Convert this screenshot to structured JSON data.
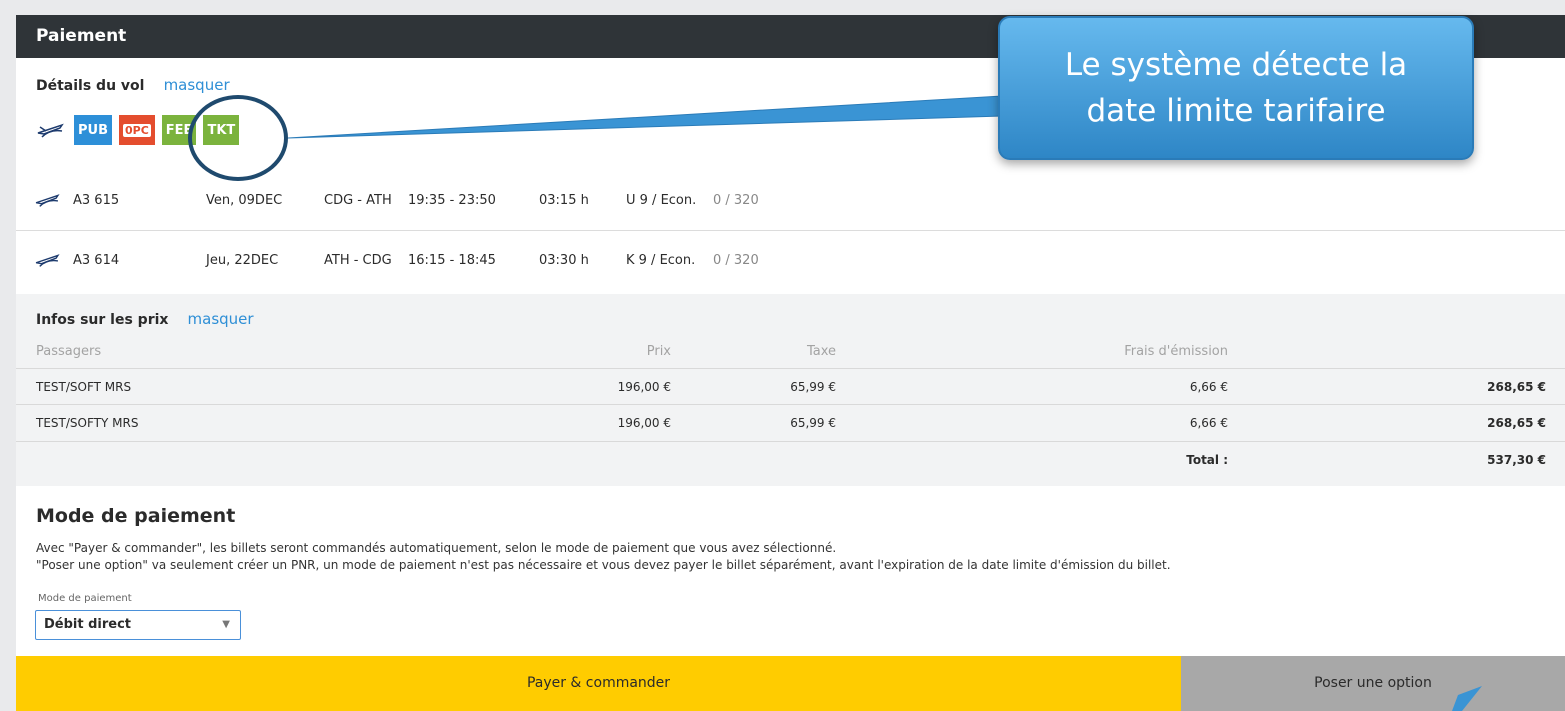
{
  "header": {
    "title": "Paiement"
  },
  "flight_details": {
    "title": "Détails du vol",
    "toggle": "masquer",
    "badges": [
      "PUB",
      "0PC",
      "FEE",
      "TKT"
    ],
    "flights": [
      {
        "number": "A3 615",
        "date": "Ven, 09DEC",
        "route": "CDG - ATH",
        "times": "19:35 - 23:50",
        "duration": "03:15 h",
        "class": "U 9 / Econ.",
        "seats": "0 / 320"
      },
      {
        "number": "A3 614",
        "date": "Jeu, 22DEC",
        "route": "ATH - CDG",
        "times": "16:15 - 18:45",
        "duration": "03:30 h",
        "class": "K 9 / Econ.",
        "seats": "0 / 320"
      }
    ]
  },
  "prices": {
    "title": "Infos sur les prix",
    "toggle": "masquer",
    "headers": {
      "passengers": "Passagers",
      "price": "Prix",
      "tax": "Taxe",
      "fee": "Frais d'émission"
    },
    "rows": [
      {
        "name": "TEST/SOFT MRS",
        "price": "196,00 €",
        "tax": "65,99 €",
        "fee": "6,66 €",
        "total": "268,65 €"
      },
      {
        "name": "TEST/SOFTY MRS",
        "price": "196,00 €",
        "tax": "65,99 €",
        "fee": "6,66 €",
        "total": "268,65 €"
      }
    ],
    "total_label": "Total :",
    "total_value": "537,30 €"
  },
  "payment": {
    "title": "Mode de paiement",
    "desc_line1": "Avec \"Payer & commander\", les billets seront commandés automatiquement, selon le mode de paiement que vous avez sélectionné.",
    "desc_line2": "\"Poser une option\" va seulement créer un PNR, un mode de paiement n'est pas nécessaire et vous devez payer le billet séparément, avant l'expiration de la date limite d'émission du billet.",
    "select_label": "Mode de paiement",
    "select_value": "Débit direct",
    "pay_button": "Payer & commander",
    "option_button": "Poser une option"
  },
  "callout": {
    "line1": "Le système détecte la",
    "line2": "date limite tarifaire"
  },
  "colors": {
    "header": "#2f3438",
    "pay": "#ffcc00",
    "option": "#a8a8a8",
    "link": "#2f8fd6",
    "callout": "#3a94d4"
  }
}
